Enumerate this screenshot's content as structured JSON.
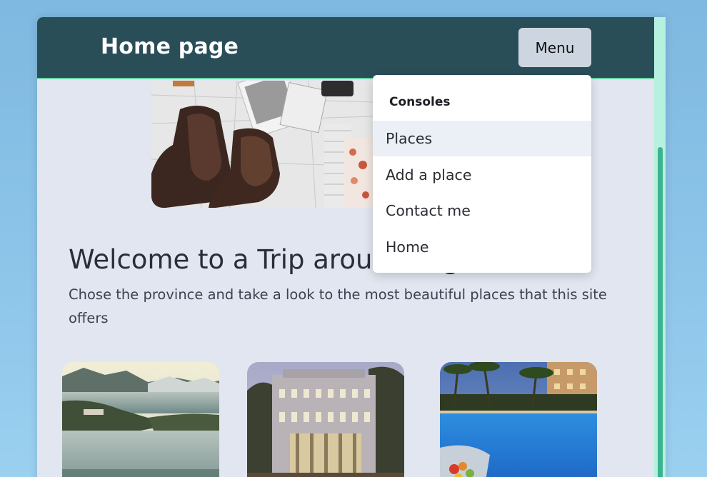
{
  "header": {
    "title": "Home page",
    "menu_button": "Menu"
  },
  "dropdown": {
    "header": "Consoles",
    "items": [
      {
        "label": "Places",
        "active": true
      },
      {
        "label": "Add a place",
        "active": false
      },
      {
        "label": "Contact me",
        "active": false
      },
      {
        "label": "Home",
        "active": false
      }
    ]
  },
  "welcome": {
    "heading": "Welcome to a Trip around Argentina",
    "subtitle": "Chose the province and take a look to the most beautiful places that this site offers"
  },
  "colors": {
    "header_bg": "#2a4e58",
    "page_bg": "#e1e6f0",
    "accent": "#3bb38f",
    "menu_button_bg": "#cdd6e0"
  }
}
